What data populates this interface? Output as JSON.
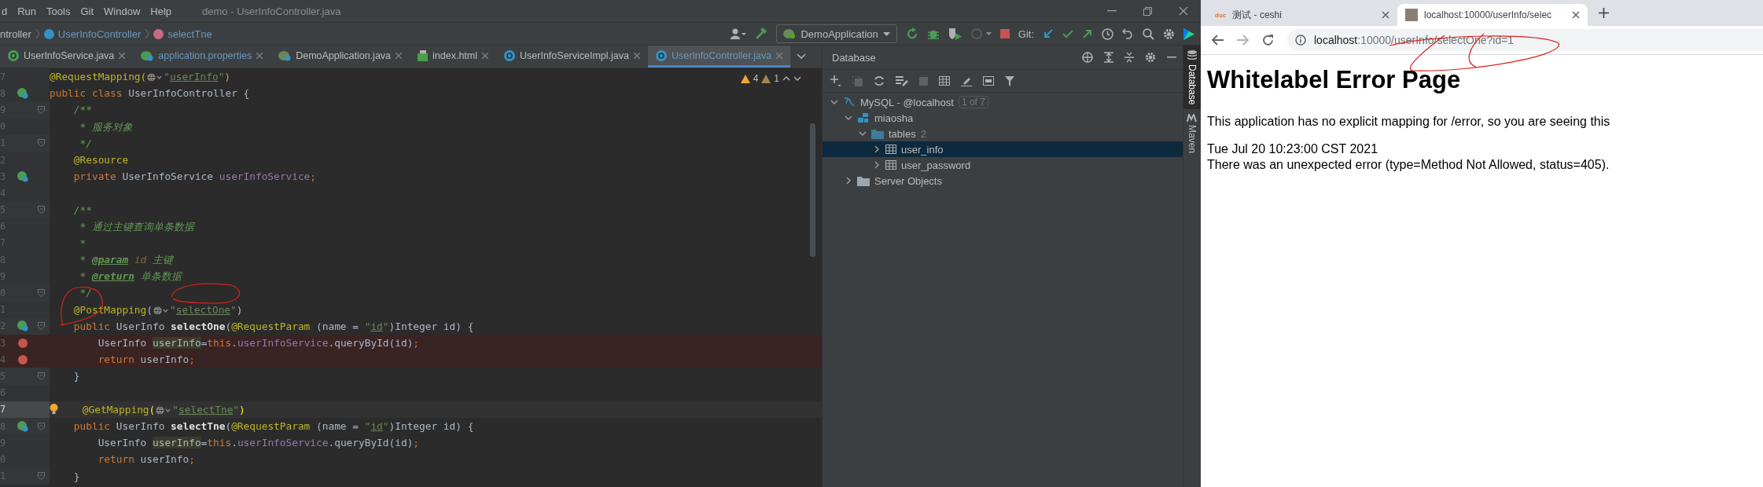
{
  "ide": {
    "menu": [
      "d",
      "Run",
      "Tools",
      "Git",
      "Window",
      "Help"
    ],
    "window_title": "demo - UserInfoController.java",
    "breadcrumbs": [
      {
        "label": "ntroller",
        "kind": "text"
      },
      {
        "label": "UserInfoController",
        "kind": "class"
      },
      {
        "label": "selectTne",
        "kind": "method"
      }
    ],
    "run_config": "DemoApplication",
    "git_label": "Git:",
    "editor_tabs": [
      {
        "label": "UserInfoService.java",
        "kind": "interface",
        "selected": false
      },
      {
        "label": "application.properties",
        "kind": "properties",
        "selected": false
      },
      {
        "label": "DemoApplication.java",
        "kind": "spring",
        "selected": false
      },
      {
        "label": "index.html",
        "kind": "html",
        "selected": false
      },
      {
        "label": "UserInfoServiceImpl.java",
        "kind": "class",
        "selected": false
      },
      {
        "label": "UserInfoController.java",
        "kind": "class",
        "selected": true
      }
    ],
    "inspections": {
      "warnings": "4",
      "weak_warnings": "1"
    },
    "code_lines": [
      {
        "num": "7",
        "kind": "plain",
        "fold_marker": false,
        "breakpoint": false,
        "caret_line": false,
        "tokens": [
          {
            "kind": "ann",
            "t": "@RequestMapping("
          },
          {
            "kind": "globe"
          },
          {
            "kind": "str",
            "t": "\""
          },
          {
            "kind": "strlink",
            "t": "userInfo"
          },
          {
            "kind": "str",
            "t": "\""
          },
          {
            "kind": "ann",
            "t": ")"
          }
        ]
      },
      {
        "num": "8",
        "kind": "bean",
        "fold_marker": false,
        "breakpoint": false,
        "caret_line": false,
        "tokens": [
          {
            "kind": "kw",
            "t": "public class "
          },
          {
            "kind": "plain",
            "t": "UserInfoController {"
          }
        ]
      },
      {
        "num": "9",
        "kind": "plain",
        "fold_marker": true,
        "breakpoint": false,
        "caret_line": false,
        "tokens": [
          {
            "kind": "cm",
            "t": "    /**"
          }
        ]
      },
      {
        "num": "0",
        "kind": "plain",
        "fold_marker": false,
        "breakpoint": false,
        "caret_line": false,
        "tokens": [
          {
            "kind": "cm",
            "t": "     * 服务对象"
          }
        ]
      },
      {
        "num": "1",
        "kind": "plain",
        "fold_marker": true,
        "breakpoint": false,
        "caret_line": false,
        "tokens": [
          {
            "kind": "cm",
            "t": "     */"
          }
        ]
      },
      {
        "num": "2",
        "kind": "plain",
        "fold_marker": false,
        "breakpoint": false,
        "caret_line": false,
        "tokens": [
          {
            "kind": "ann",
            "t": "    @Resource"
          }
        ]
      },
      {
        "num": "3",
        "kind": "bean",
        "fold_marker": false,
        "breakpoint": false,
        "caret_line": false,
        "tokens": [
          {
            "kind": "kw",
            "t": "    private "
          },
          {
            "kind": "plain",
            "t": "UserInfoService "
          },
          {
            "kind": "field",
            "t": "userInfoService"
          },
          {
            "kind": "kw",
            "t": ";"
          }
        ]
      },
      {
        "num": "4",
        "kind": "plain",
        "fold_marker": false,
        "breakpoint": false,
        "caret_line": false
      },
      {
        "num": "5",
        "kind": "plain",
        "fold_marker": true,
        "breakpoint": false,
        "caret_line": false,
        "tokens": [
          {
            "kind": "cm",
            "t": "    /**"
          }
        ]
      },
      {
        "num": "6",
        "kind": "plain",
        "fold_marker": false,
        "breakpoint": false,
        "caret_line": false,
        "tokens": [
          {
            "kind": "cm",
            "t": "     * 通过主键查询单条数据"
          }
        ]
      },
      {
        "num": "7",
        "kind": "plain",
        "fold_marker": false,
        "breakpoint": false,
        "caret_line": false,
        "tokens": [
          {
            "kind": "cm",
            "t": "     *"
          }
        ]
      },
      {
        "num": "8",
        "kind": "plain",
        "fold_marker": false,
        "breakpoint": false,
        "caret_line": false,
        "tokens": [
          {
            "kind": "cm",
            "t": "     * "
          },
          {
            "kind": "cmtag",
            "t": "@param"
          },
          {
            "kind": "cmval",
            "t": " id"
          },
          {
            "kind": "cm",
            "t": " 主键"
          }
        ]
      },
      {
        "num": "9",
        "kind": "plain",
        "fold_marker": false,
        "breakpoint": false,
        "caret_line": false,
        "tokens": [
          {
            "kind": "cm",
            "t": "     * "
          },
          {
            "kind": "cmtag",
            "t": "@return"
          },
          {
            "kind": "cm",
            "t": " 单条数据"
          }
        ]
      },
      {
        "num": "0",
        "kind": "plain",
        "fold_marker": true,
        "breakpoint": false,
        "caret_line": false,
        "tokens": [
          {
            "kind": "cm",
            "t": "     */"
          }
        ]
      },
      {
        "num": "1",
        "kind": "plain",
        "fold_marker": false,
        "breakpoint": false,
        "caret_line": false,
        "tokens": [
          {
            "kind": "ann",
            "t": "    @PostMapping"
          },
          {
            "kind": "plain",
            "t": "("
          },
          {
            "kind": "globe"
          },
          {
            "kind": "str",
            "t": "\""
          },
          {
            "kind": "strlink",
            "t": "selectOne"
          },
          {
            "kind": "str",
            "t": "\""
          },
          {
            "kind": "plain",
            "t": ")"
          }
        ]
      },
      {
        "num": "2",
        "kind": "bean",
        "fold_marker": true,
        "breakpoint": false,
        "caret_line": false,
        "tokens": [
          {
            "kind": "kw",
            "t": "    public "
          },
          {
            "kind": "plain",
            "t": "UserInfo "
          },
          {
            "kind": "bold",
            "t": "selectOne"
          },
          {
            "kind": "plain",
            "t": "("
          },
          {
            "kind": "ann",
            "t": "@RequestParam"
          },
          {
            "kind": "plain",
            "t": " (name = "
          },
          {
            "kind": "str",
            "t": "\""
          },
          {
            "kind": "strlink",
            "t": "id"
          },
          {
            "kind": "str",
            "t": "\""
          },
          {
            "kind": "plain",
            "t": ")Integer id) {"
          }
        ]
      },
      {
        "num": "3",
        "kind": "plain",
        "fold_marker": false,
        "breakpoint": true,
        "caret_line": false,
        "tokens": [
          {
            "kind": "plain",
            "t": "        UserInfo "
          },
          {
            "kind": "hl",
            "t": "userInfo"
          },
          {
            "kind": "plain",
            "t": "="
          },
          {
            "kind": "kw",
            "t": "this"
          },
          {
            "kind": "plain",
            "t": "."
          },
          {
            "kind": "field",
            "t": "userInfoService"
          },
          {
            "kind": "plain",
            "t": ".queryById(id)"
          },
          {
            "kind": "kw",
            "t": ";"
          }
        ]
      },
      {
        "num": "4",
        "kind": "plain",
        "fold_marker": false,
        "breakpoint": true,
        "caret_line": false,
        "tokens": [
          {
            "kind": "kw",
            "t": "        return "
          },
          {
            "kind": "plain",
            "t": "userInfo"
          },
          {
            "kind": "kw",
            "t": ";"
          }
        ]
      },
      {
        "num": "5",
        "kind": "plain",
        "fold_marker": true,
        "breakpoint": false,
        "caret_line": false,
        "tokens": [
          {
            "kind": "plain",
            "t": "    }"
          }
        ]
      },
      {
        "num": "6",
        "kind": "plain",
        "fold_marker": false,
        "breakpoint": false,
        "caret_line": false
      },
      {
        "num": "7",
        "kind": "bulb",
        "fold_marker": false,
        "breakpoint": false,
        "caret_line": true,
        "tokens": [
          {
            "kind": "ann",
            "t": "    @GetMapping"
          },
          {
            "kind": "paren",
            "t": "("
          },
          {
            "kind": "globe"
          },
          {
            "kind": "str",
            "t": "\""
          },
          {
            "kind": "strlink",
            "t": "selectTne"
          },
          {
            "kind": "str",
            "t": "\""
          },
          {
            "kind": "paren",
            "t": ")"
          }
        ]
      },
      {
        "num": "8",
        "kind": "bean",
        "fold_marker": true,
        "breakpoint": false,
        "caret_line": false,
        "tokens": [
          {
            "kind": "kw",
            "t": "    public "
          },
          {
            "kind": "plain",
            "t": "UserInfo "
          },
          {
            "kind": "bold",
            "t": "selectTne"
          },
          {
            "kind": "plain",
            "t": "("
          },
          {
            "kind": "ann",
            "t": "@RequestParam"
          },
          {
            "kind": "plain",
            "t": " (name = "
          },
          {
            "kind": "str",
            "t": "\""
          },
          {
            "kind": "strlink",
            "t": "id"
          },
          {
            "kind": "str",
            "t": "\""
          },
          {
            "kind": "plain",
            "t": ")Integer id) {"
          }
        ]
      },
      {
        "num": "9",
        "kind": "plain",
        "fold_marker": false,
        "breakpoint": false,
        "caret_line": false,
        "tokens": [
          {
            "kind": "plain",
            "t": "        UserInfo "
          },
          {
            "kind": "hl",
            "t": "userInfo"
          },
          {
            "kind": "plain",
            "t": "="
          },
          {
            "kind": "kw",
            "t": "this"
          },
          {
            "kind": "plain",
            "t": "."
          },
          {
            "kind": "field",
            "t": "userInfoService"
          },
          {
            "kind": "plain",
            "t": ".queryById(id)"
          },
          {
            "kind": "kw",
            "t": ";"
          }
        ]
      },
      {
        "num": "0",
        "kind": "plain",
        "fold_marker": false,
        "breakpoint": false,
        "caret_line": false,
        "tokens": [
          {
            "kind": "kw",
            "t": "        return "
          },
          {
            "kind": "plain",
            "t": "userInfo"
          },
          {
            "kind": "kw",
            "t": ";"
          }
        ]
      },
      {
        "num": "1",
        "kind": "plain",
        "fold_marker": true,
        "breakpoint": false,
        "caret_line": false,
        "tokens": [
          {
            "kind": "plain",
            "t": "    }"
          }
        ]
      }
    ],
    "database": {
      "title": "Database",
      "tree": [
        {
          "label": "MySQL - @localhost",
          "badge": "1 of 7",
          "kind": "datasource",
          "expanded": true,
          "selected": false,
          "children": [
            {
              "label": "miaosha",
              "kind": "schema",
              "expanded": true,
              "selected": false,
              "children": [
                {
                  "label": "tables",
                  "count": "2",
                  "kind": "folder",
                  "expanded": true,
                  "selected": false,
                  "children": [
                    {
                      "label": "user_info",
                      "kind": "table",
                      "expanded": false,
                      "selected": true
                    },
                    {
                      "label": "user_password",
                      "kind": "table",
                      "expanded": false,
                      "selected": false
                    }
                  ]
                }
              ]
            },
            {
              "label": "Server Objects",
              "kind": "folder",
              "expanded": false,
              "selected": false
            }
          ]
        }
      ]
    },
    "side_tools": [
      {
        "label": "Database",
        "kind": "database",
        "selected": true
      },
      {
        "label": "Maven",
        "kind": "maven",
        "selected": false
      }
    ]
  },
  "browser": {
    "tabs": [
      {
        "title": "测试 - ceshi",
        "favicon_text": "doc",
        "selected": false
      },
      {
        "title": "localhost:10000/userInfo/selec",
        "selected": true
      }
    ],
    "url_host": "localhost",
    "url_rest": ":10000/userInfo/selectOne?id=1",
    "heading": "Whitelabel Error Page",
    "paragraph": "This application has no explicit mapping for /error, so you are seeing this",
    "lines": [
      "Tue Jul 20 10:23:00 CST 2021",
      "There was an unexpected error (type=Method Not Allowed, status=405)."
    ]
  }
}
